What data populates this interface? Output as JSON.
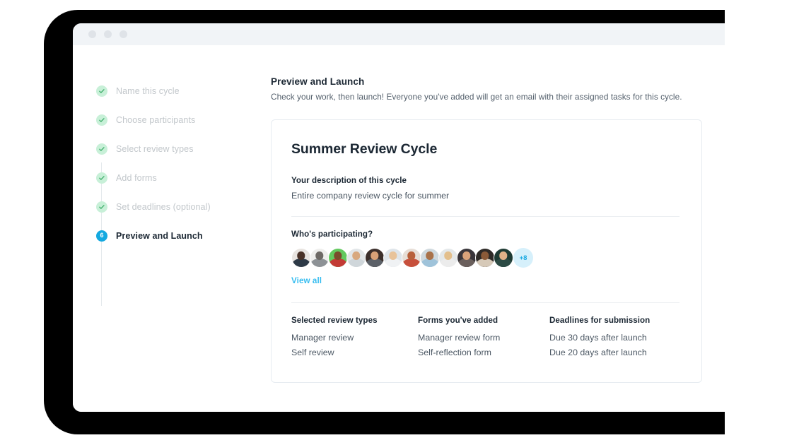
{
  "window": {
    "traffic_lights": [
      "window-close-dot",
      "window-minimize-dot",
      "window-maximize-dot"
    ]
  },
  "stepper": {
    "steps": [
      {
        "label": "Name this cycle",
        "state": "done",
        "marker": "check-icon"
      },
      {
        "label": "Choose participants",
        "state": "done",
        "marker": "check-icon"
      },
      {
        "label": "Select review types",
        "state": "done",
        "marker": "check-icon"
      },
      {
        "label": "Add forms",
        "state": "done",
        "marker": "check-icon"
      },
      {
        "label": "Set deadlines (optional)",
        "state": "done",
        "marker": "check-icon"
      },
      {
        "label": "Preview and Launch",
        "state": "current",
        "marker": "6"
      }
    ]
  },
  "panel": {
    "title": "Preview and Launch",
    "subtitle": "Check your work, then launch! Everyone you've added will get an email with their assigned tasks for this cycle."
  },
  "card": {
    "title": "Summer Review Cycle",
    "description_label": "Your description of this cycle",
    "description_value": "Entire company review cycle for summer",
    "participants_label": "Who's participating?",
    "participants_overflow": "+8",
    "view_all_label": "View all",
    "participants": [
      {
        "name": "participant-1",
        "bg": "#e8e4e0",
        "head": "#4a3228",
        "body": "#2d3a47"
      },
      {
        "name": "participant-2",
        "bg": "#efefed",
        "head": "#6e6a66",
        "body": "#8d9296"
      },
      {
        "name": "participant-3",
        "bg": "#63c95f",
        "head": "#7a4c2c",
        "body": "#c33a35"
      },
      {
        "name": "participant-4",
        "bg": "#e2e6e8",
        "head": "#d8a87e",
        "body": "#cfd6da"
      },
      {
        "name": "participant-5",
        "bg": "#3c2f2b",
        "head": "#d9a177",
        "body": "#5c6168"
      },
      {
        "name": "participant-6",
        "bg": "#dfe5ea",
        "head": "#e8c39a",
        "body": "#f0f2f4"
      },
      {
        "name": "participant-7",
        "bg": "#e7ded6",
        "head": "#b8603a",
        "body": "#c7503c"
      },
      {
        "name": "participant-8",
        "bg": "#cfd9de",
        "head": "#a9724a",
        "body": "#9fc3da"
      },
      {
        "name": "participant-9",
        "bg": "#e4e8ea",
        "head": "#e3bf8c",
        "body": "#ececec"
      },
      {
        "name": "participant-10",
        "bg": "#39353a",
        "head": "#d9a27a",
        "body": "#6a5f5c"
      },
      {
        "name": "participant-11",
        "bg": "#2e2a27",
        "head": "#8a5a38",
        "body": "#d6c9b8"
      },
      {
        "name": "participant-12",
        "bg": "#1e3a33",
        "head": "#e0b188",
        "body": "#2c4a44"
      }
    ],
    "columns": [
      {
        "heading": "Selected review types",
        "items": [
          "Manager review",
          "Self review"
        ]
      },
      {
        "heading": "Forms you've added",
        "items": [
          "Manager review form",
          "Self-reflection form"
        ]
      },
      {
        "heading": "Deadlines for submission",
        "items": [
          "Due 30 days after launch",
          "Due 20 days after launch"
        ]
      }
    ]
  },
  "colors": {
    "accent_blue": "#14a9e0",
    "link_blue": "#37bdf0",
    "done_green": "#c8f0d8",
    "check_green": "#3fae6a",
    "text_dark": "#1b2733",
    "text_muted": "#c2c7cb"
  }
}
